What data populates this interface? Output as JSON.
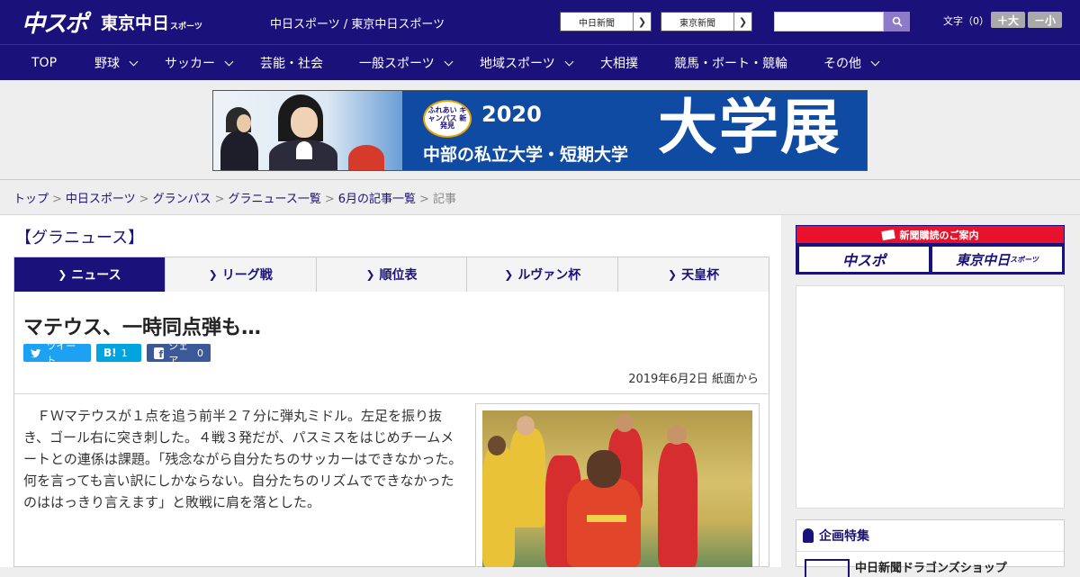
{
  "header": {
    "logo_main": "中スポ",
    "logo_tokyo": "東京中日",
    "logo_tokyo_small": "スポーツ",
    "site_names": "中日スポーツ / 東京中日スポーツ",
    "paper_links": [
      {
        "label": "中日新聞",
        "icon": "chevron-right-icon"
      },
      {
        "label": "東京新聞",
        "icon": "chevron-right-icon"
      }
    ],
    "search": {
      "value": "",
      "placeholder": "",
      "icon": "search-icon"
    },
    "font_size_label": "文字（0）",
    "font_bigger": "＋大",
    "font_smaller": "－小"
  },
  "nav": {
    "items": [
      {
        "label": "TOP",
        "has_dropdown": false
      },
      {
        "label": "野球",
        "has_dropdown": true
      },
      {
        "label": "サッカー",
        "has_dropdown": true
      },
      {
        "label": "芸能・社会",
        "has_dropdown": false
      },
      {
        "label": "一般スポーツ",
        "has_dropdown": true
      },
      {
        "label": "地域スポーツ",
        "has_dropdown": true
      },
      {
        "label": "大相撲",
        "has_dropdown": false
      },
      {
        "label": "競馬・ボート・競輪",
        "has_dropdown": false
      },
      {
        "label": "その他",
        "has_dropdown": true
      }
    ]
  },
  "banner": {
    "logo_text": "ふれあい キャンパス 新発見",
    "year": "2020",
    "subtitle": "中部の私立大学・短期大学",
    "big_text": "大学展"
  },
  "breadcrumb": {
    "items": [
      "トップ",
      "中日スポーツ",
      "グランパス",
      "グラニュース一覧",
      "6月の記事一覧"
    ],
    "current": "記事",
    "separator": ">"
  },
  "section": {
    "title": "【グラニュース】"
  },
  "tabs": [
    {
      "label": "ニュース",
      "active": true
    },
    {
      "label": "リーグ戦",
      "active": false
    },
    {
      "label": "順位表",
      "active": false
    },
    {
      "label": "ルヴァン杯",
      "active": false
    },
    {
      "label": "天皇杯",
      "active": false
    }
  ],
  "article": {
    "headline": "マテウス、一時同点弾も…",
    "share": {
      "tweet": {
        "icon": "twitter-icon",
        "label": "ツイート",
        "color": "#1da1f2"
      },
      "hatena": {
        "icon": "hatena-bookmark-icon",
        "label": "B!",
        "count": "1",
        "color": "#00a4de"
      },
      "facebook": {
        "icon": "facebook-icon",
        "label": "シェア",
        "count": "0",
        "color": "#3b5998"
      }
    },
    "date": "2019年6月2日 紙面から",
    "body": "　ＦＷマテウスが１点を追う前半２７分に弾丸ミドル。左足を振り抜き、ゴール右に突き刺した。４戦３発だが、パスミスをはじめチームメートとの連係は課題。「残念ながら自分たちのサッカーはできなかった。何を言っても言い訳にしかならない。自分たちのリズムでできなかったのははっきり言えます」と敗戦に肩を落とした。",
    "photo_icon": "soccer-player-photo"
  },
  "sidebar": {
    "subscribe_label": "新聞購読のご案内",
    "subscribe_icon": "newspaper-icon",
    "chuspo": "中スポ",
    "tokyo": "東京中日",
    "tokyo_small": "スポーツ",
    "feature_title": "企画特集",
    "feature_icon": "ribbon-badge-icon",
    "feature_item": "中日新聞ドラゴンズショップ"
  },
  "colors": {
    "brand_navy": "#1b117a",
    "accent_red": "#e8122c",
    "search_purple": "#8d7ac8",
    "link": "#1b117a"
  }
}
